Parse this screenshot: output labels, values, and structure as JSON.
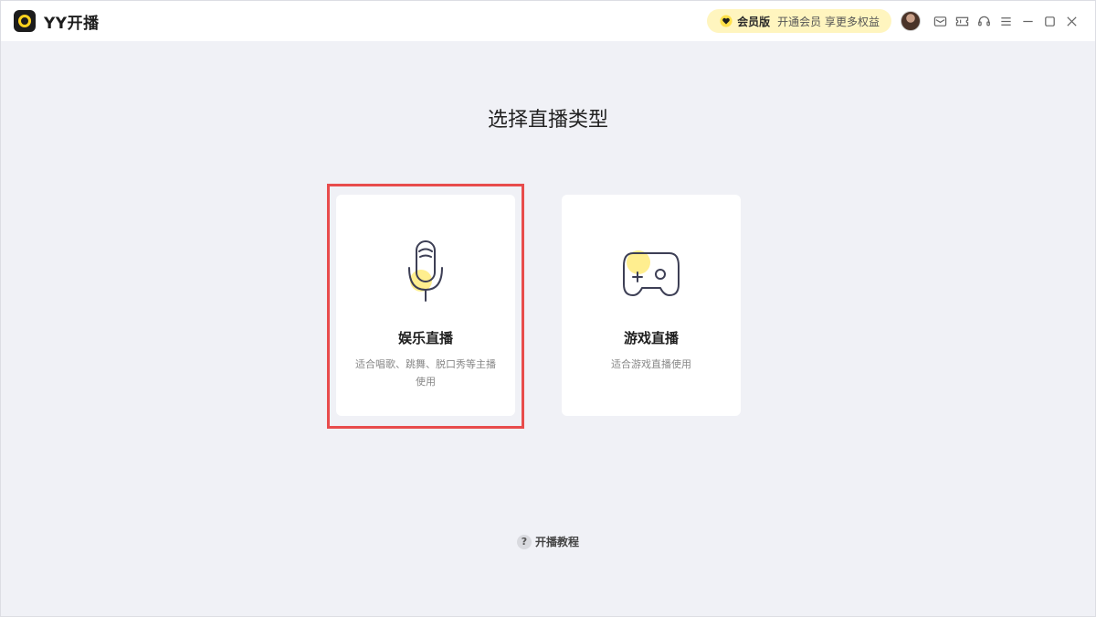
{
  "app": {
    "name": "YY开播"
  },
  "titlebar": {
    "vip_label": "会员版",
    "vip_promo": "开通会员 享更多权益",
    "icons": [
      "avatar",
      "mail-icon",
      "ticket-icon",
      "headset-icon",
      "menu-icon",
      "minimize-icon",
      "maximize-icon",
      "close-icon"
    ]
  },
  "main": {
    "title": "选择直播类型",
    "cards": [
      {
        "id": "entertainment",
        "title": "娱乐直播",
        "desc": "适合唱歌、跳舞、脱口秀等主播使用",
        "icon": "microphone-icon",
        "selected": true
      },
      {
        "id": "game",
        "title": "游戏直播",
        "desc": "适合游戏直播使用",
        "icon": "gamepad-icon",
        "selected": false
      }
    ],
    "help": {
      "icon": "?",
      "label": "开播教程"
    }
  },
  "colors": {
    "accent": "#ffd21e",
    "vip_bg": "#fff5bf",
    "selection": "#e84c4c",
    "background": "#f0f1f6"
  }
}
